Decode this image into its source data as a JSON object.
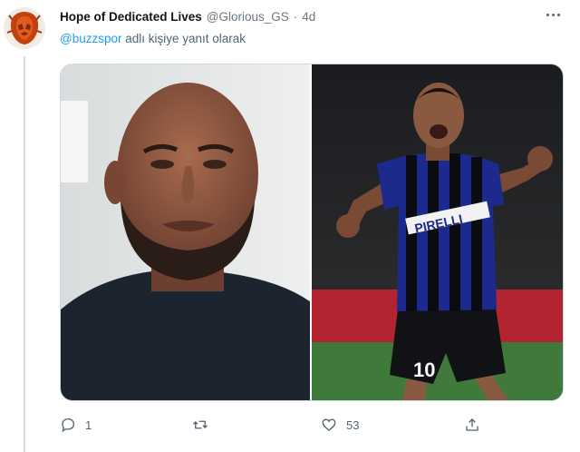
{
  "tweet": {
    "author_name": "Hope of Dedicated Lives",
    "author_handle": "@Glorious_GS",
    "separator": "·",
    "time": "4d",
    "reply_mention": "@buzzspor",
    "reply_text": "adlı kişiye yanıt olarak"
  },
  "photos": {
    "left": {
      "description_icon": "photo-left"
    },
    "right": {
      "jersey_sponsor": "PIRELLI",
      "shirt_number": "10"
    }
  },
  "actions": {
    "reply_count": "1",
    "retweet_count": "",
    "like_count": "53",
    "share_count": ""
  },
  "colors": {
    "accent": "#1d9bf0",
    "muted": "#536471",
    "border": "#cfd9de"
  },
  "icons": {
    "more": "more-icon",
    "reply": "reply-icon",
    "retweet": "retweet-icon",
    "like": "heart-icon",
    "share": "share-icon",
    "avatar": "lion-avatar-icon"
  }
}
